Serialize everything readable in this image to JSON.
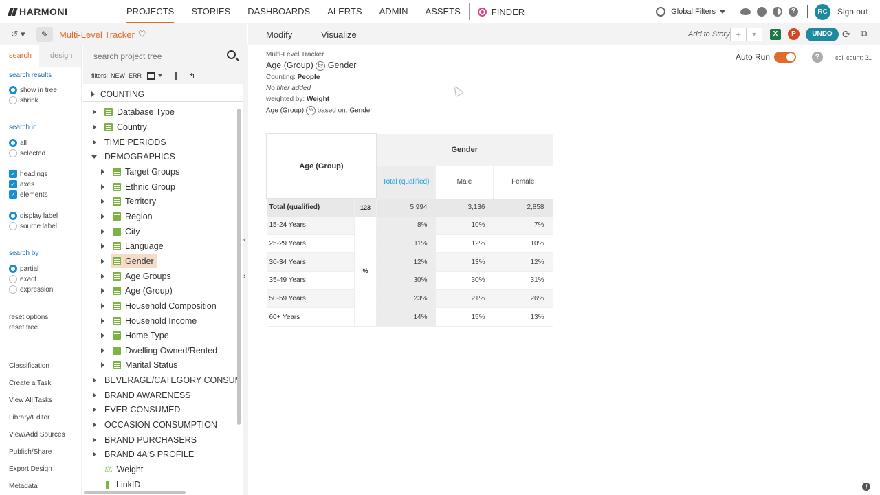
{
  "app": {
    "logo": "HARMONI"
  },
  "nav": {
    "items": [
      "PROJECTS",
      "STORIES",
      "DASHBOARDS",
      "ALERTS",
      "ADMIN",
      "ASSETS"
    ],
    "finder": "FINDER",
    "global_filters": "Global Filters",
    "avatar": "RC",
    "sign_out": "Sign out"
  },
  "report": {
    "title": "Multi-Level Tracker",
    "tab_modify": "Modify",
    "tab_visualize": "Visualize",
    "add_to_story": "Add to Story",
    "undo": "UNDO",
    "excel": "X",
    "ppt": "P"
  },
  "sidebar": {
    "tab_search": "search",
    "tab_design": "design",
    "search_results_title": "search results",
    "show_in_tree": "show in tree",
    "shrink": "shrink",
    "search_in_title": "search in",
    "all": "all",
    "selected": "selected",
    "headings": "headings",
    "axes": "axes",
    "elements": "elements",
    "display_label": "display label",
    "source_label": "source label",
    "search_by_title": "search by",
    "partial": "partial",
    "exact": "exact",
    "expression": "expression",
    "reset_options": "reset options",
    "reset_tree": "reset tree",
    "links": [
      "Classification",
      "Create a Task",
      "View All Tasks",
      "Library/Editor",
      "View/Add Sources",
      "Publish/Share",
      "Export Design",
      "Metadata"
    ]
  },
  "tree": {
    "search_placeholder": "search project tree",
    "filters_label": "filters:",
    "filter_new": "NEW",
    "filter_err": "ERR",
    "counting": "COUNTING",
    "rows": [
      "Database Type",
      "Country",
      "TIME PERIODS",
      "DEMOGRAPHICS",
      "Target Groups",
      "Ethnic Group",
      "Territory",
      "Region",
      "City",
      "Language",
      "Gender",
      "Age Groups",
      "Age (Group)",
      "Household Composition",
      "Household Income",
      "Home Type",
      "Dwelling Owned/Rented",
      "Marital Status",
      "BEVERAGE/CATEGORY CONSUMER",
      "BRAND AWARENESS",
      "EVER CONSUMED",
      "OCCASION CONSUMPTION",
      "BRAND PURCHASERS",
      "BRAND 4A'S PROFILE",
      "Weight",
      "LinkID"
    ]
  },
  "main": {
    "meta_title": "Multi-Level Tracker",
    "row_var": "Age (Group)",
    "by": "by",
    "col_var": "Gender",
    "counting_label": "Counting:",
    "counting_value": "People",
    "no_filter": "No filter added",
    "weighted_label": "weighted by:",
    "weighted_value": "Weight",
    "pct_var": "Age (Group)",
    "pct_symbol": "%",
    "based_on_label": "based on:",
    "based_on_value": "Gender",
    "auto_run": "Auto Run",
    "cell_count": "cell count: 21",
    "help": "?",
    "info": "i"
  },
  "table": {
    "corner": "Age (Group)",
    "col_group": "Gender",
    "columns": [
      "Total (qualified)",
      "Male",
      "Female"
    ],
    "total_row": {
      "label": "Total (qualified)",
      "stat": "123",
      "values": [
        "5,994",
        "3,136",
        "2,858"
      ]
    },
    "pct_stat": "%",
    "rows": [
      {
        "label": "15-24 Years",
        "values": [
          "8%",
          "10%",
          "7%"
        ]
      },
      {
        "label": "25-29 Years",
        "values": [
          "11%",
          "12%",
          "10%"
        ]
      },
      {
        "label": "30-34 Years",
        "values": [
          "12%",
          "13%",
          "12%"
        ]
      },
      {
        "label": "35-49 Years",
        "values": [
          "30%",
          "30%",
          "31%"
        ]
      },
      {
        "label": "50-59 Years",
        "values": [
          "23%",
          "21%",
          "26%"
        ]
      },
      {
        "label": "60+ Years",
        "values": [
          "14%",
          "15%",
          "13%"
        ]
      }
    ]
  }
}
